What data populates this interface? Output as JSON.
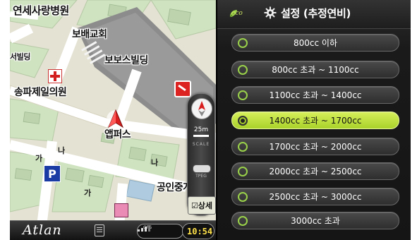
{
  "map": {
    "labels": [
      {
        "text": "연세사랑병원"
      },
      {
        "text": "보배교회"
      },
      {
        "text": "보보스빌딩"
      },
      {
        "text": "송파제일의원"
      },
      {
        "text": "서빌딩"
      },
      {
        "text": "앱퍼스"
      },
      {
        "text": "공인중개사의"
      }
    ],
    "scale_value": "25m",
    "scale_word": "SCALE",
    "tpeg_word": "TPEG",
    "detail_button": "☑상세"
  },
  "bottom_bar": {
    "logo": "Atlan",
    "gps_label": "GPS",
    "time": "10:54"
  },
  "panel": {
    "eco_badge": "eco",
    "title": "설정 (추정연비)",
    "options": [
      {
        "label": "800cc 이하",
        "selected": false
      },
      {
        "label": "800cc 초과 ~ 1100cc",
        "selected": false
      },
      {
        "label": "1100cc 초과 ~ 1400cc",
        "selected": false
      },
      {
        "label": "1400cc 초과 ~ 1700cc",
        "selected": true
      },
      {
        "label": "1700cc 초과 ~ 2000cc",
        "selected": false
      },
      {
        "label": "2000cc 초과 ~ 2500cc",
        "selected": false
      },
      {
        "label": "2500cc 초과 ~ 3000cc",
        "selected": false
      },
      {
        "label": "3000cc 초과",
        "selected": false
      }
    ]
  },
  "colors": {
    "accent_green": "#a9d22a",
    "time_yellow": "#ffe24a"
  },
  "icons": [
    "gear-icon",
    "eco-leaf-icon",
    "compass-icon",
    "radio-icon",
    "hospital-cross-icon",
    "parking-icon",
    "menu-icon",
    "gps-signal-icon",
    "navigation-arrow-icon"
  ]
}
